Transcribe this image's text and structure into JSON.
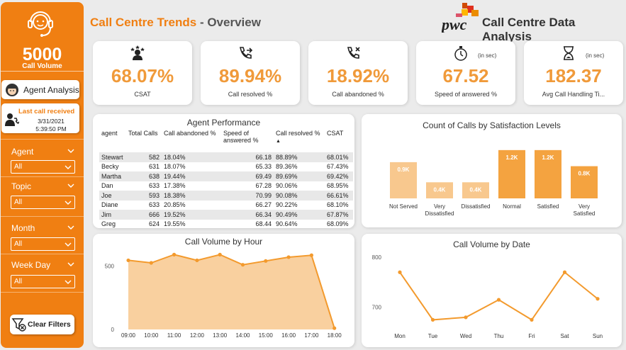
{
  "sidebar": {
    "volume_value": "5000",
    "volume_label": "Call Volume",
    "agent_button": "Agent Analysis",
    "last_call": {
      "title": "Last call received",
      "date": "3/31/2021",
      "time": "5:39:50 PM"
    },
    "filters": [
      {
        "label": "Agent",
        "value": "All"
      },
      {
        "label": "Topic",
        "value": "All"
      },
      {
        "label": "Month",
        "value": "All"
      },
      {
        "label": "Week Day",
        "value": "All"
      }
    ],
    "clear_button": "Clear Filters"
  },
  "header": {
    "title_main": "Call Centre Trends",
    "title_sep": " - ",
    "title_sub": "Overview",
    "logo_text": "pwc",
    "right_title": "Call Centre Data Analysis"
  },
  "kpis": [
    {
      "icon": "agent-team-icon",
      "value": "68.07%",
      "label": "CSAT",
      "note": ""
    },
    {
      "icon": "phone-outgoing-icon",
      "value": "89.94%",
      "label": "Call resolved %",
      "note": ""
    },
    {
      "icon": "phone-missed-icon",
      "value": "18.92%",
      "label": "Call abandoned %",
      "note": ""
    },
    {
      "icon": "stopwatch-icon",
      "value": "67.52",
      "label": "Speed of answered %",
      "note": "(in sec)"
    },
    {
      "icon": "hourglass-icon",
      "value": "182.37",
      "label": "Avg Call Handling Ti...",
      "note": "(in sec)"
    }
  ],
  "agent_table": {
    "title": "Agent Performance",
    "columns": [
      "agent",
      "Total Calls",
      "Call abandoned %",
      "Speed of answered %",
      "Call resolved %",
      "CSAT"
    ],
    "rows": [
      [
        "Stewart",
        "582",
        "18.04%",
        "66.18",
        "88.89%",
        "68.01%"
      ],
      [
        "Becky",
        "631",
        "18.07%",
        "65.33",
        "89.36%",
        "67.43%"
      ],
      [
        "Martha",
        "638",
        "19.44%",
        "69.49",
        "89.69%",
        "69.42%"
      ],
      [
        "Dan",
        "633",
        "17.38%",
        "67.28",
        "90.06%",
        "68.95%"
      ],
      [
        "Joe",
        "593",
        "18.38%",
        "70.99",
        "90.08%",
        "66.61%"
      ],
      [
        "Diane",
        "633",
        "20.85%",
        "66.27",
        "90.22%",
        "68.10%"
      ],
      [
        "Jim",
        "666",
        "19.52%",
        "66.34",
        "90.49%",
        "67.87%"
      ],
      [
        "Greg",
        "624",
        "19.55%",
        "68.44",
        "90.64%",
        "68.09%"
      ]
    ]
  },
  "colors": {
    "accent": "#f07f12",
    "kpi_value": "#f09a3a",
    "bar": "#f4a340",
    "area": "#f8c88e",
    "line": "#f39a2d"
  },
  "chart_data": [
    {
      "type": "bar",
      "title": "Count of Calls by Satisfaction Levels",
      "categories": [
        "Not Served",
        "Very Dissatisfied",
        "Dissatisfied",
        "Normal",
        "Satisfied",
        "Very Satisfied"
      ],
      "values": [
        0.9,
        0.4,
        0.4,
        1.2,
        1.2,
        0.8
      ],
      "value_labels": [
        "0.9K",
        "0.4K",
        "0.4K",
        "1.2K",
        "1.2K",
        "0.8K"
      ],
      "ylim": [
        0,
        1.25
      ]
    },
    {
      "type": "area",
      "title": "Call Volume by Hour",
      "x": [
        "09:00",
        "10:00",
        "11:00",
        "12:00",
        "13:00",
        "14:00",
        "15:00",
        "16:00",
        "17:00",
        "18:00"
      ],
      "values": [
        545,
        525,
        590,
        545,
        590,
        510,
        540,
        570,
        585,
        10
      ],
      "yticks": [
        "0",
        "500"
      ],
      "ylim": [
        0,
        620
      ]
    },
    {
      "type": "line",
      "title": "Call Volume by Date",
      "x": [
        "Mon",
        "Tue",
        "Wed",
        "Thu",
        "Fri",
        "Sat",
        "Sun"
      ],
      "values": [
        770,
        675,
        680,
        715,
        675,
        770,
        717
      ],
      "yticks": [
        "700",
        "800"
      ],
      "ylim": [
        660,
        810
      ]
    }
  ]
}
